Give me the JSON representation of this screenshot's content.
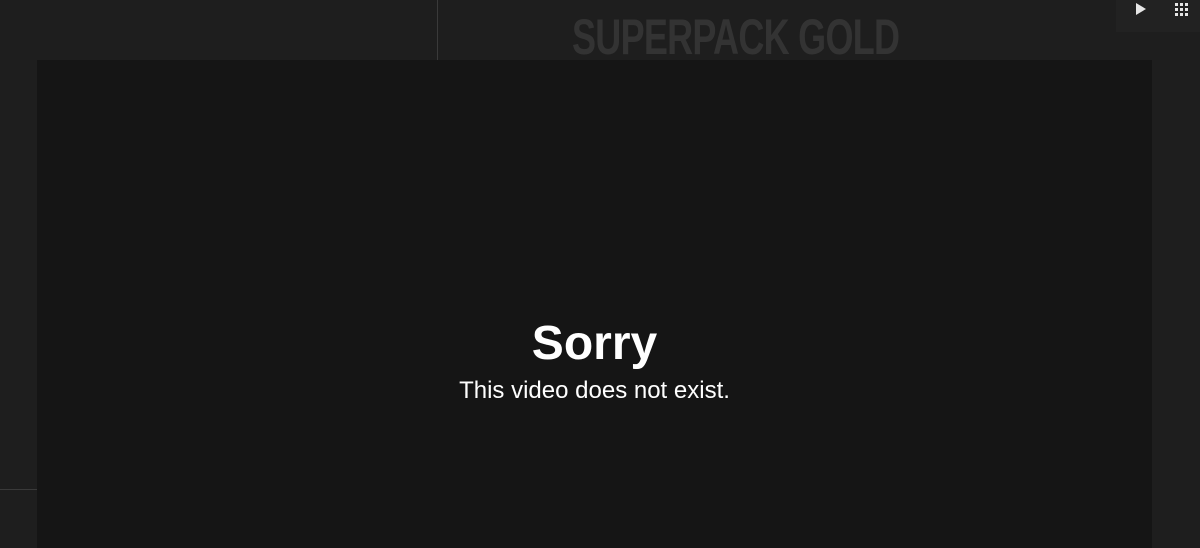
{
  "background": {
    "brand_logo_text": "SUPERPACK GOLD"
  },
  "controls": {
    "play_icon": "play-icon",
    "grid_icon": "grid-icon"
  },
  "error": {
    "title": "Sorry",
    "message": "This video does not exist."
  },
  "colors": {
    "page_background": "#1e1e1e",
    "overlay_background": "#151515",
    "text": "#ffffff",
    "logo": "#333333"
  }
}
